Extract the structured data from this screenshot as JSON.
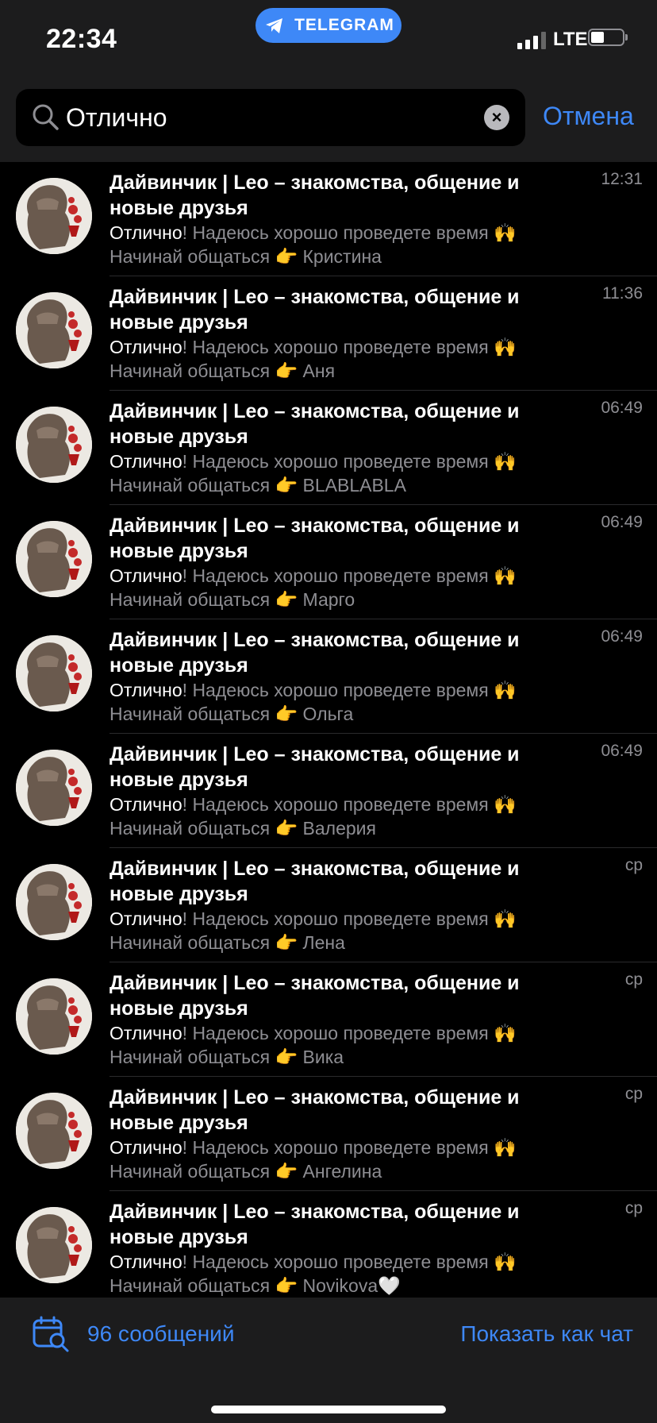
{
  "status_bar": {
    "time": "22:34",
    "app_pill": "TELEGRAM",
    "network": "LTE"
  },
  "search": {
    "query": "Отлично",
    "cancel_label": "Отмена"
  },
  "results": [
    {
      "title": "Дайвинчик | Leo – знакомства, общение и новые друзья",
      "time": "12:31",
      "highlight": "Отлично",
      "rest": "! Надеюсь хорошо проведете время 🙌",
      "line2": "Начинай общаться 👉 Кристина"
    },
    {
      "title": "Дайвинчик | Leo – знакомства, общение и новые друзья",
      "time": "11:36",
      "highlight": "Отлично",
      "rest": "! Надеюсь хорошо проведете время 🙌",
      "line2": "Начинай общаться 👉 Аня"
    },
    {
      "title": "Дайвинчик | Leo – знакомства, общение и новые друзья",
      "time": "06:49",
      "highlight": "Отлично",
      "rest": "! Надеюсь хорошо проведете время 🙌",
      "line2": "Начинай общаться 👉 BLABLABLA"
    },
    {
      "title": "Дайвинчик | Leo – знакомства, общение и новые друзья",
      "time": "06:49",
      "highlight": "Отлично",
      "rest": "! Надеюсь хорошо проведете время 🙌",
      "line2": "Начинай общаться 👉 Марго"
    },
    {
      "title": "Дайвинчик | Leo – знакомства, общение и новые друзья",
      "time": "06:49",
      "highlight": "Отлично",
      "rest": "! Надеюсь хорошо проведете время 🙌",
      "line2": "Начинай общаться 👉 Ольга"
    },
    {
      "title": "Дайвинчик | Leo – знакомства, общение и новые друзья",
      "time": "06:49",
      "highlight": "Отлично",
      "rest": "! Надеюсь хорошо проведете время 🙌",
      "line2": "Начинай общаться 👉 Валерия"
    },
    {
      "title": "Дайвинчик | Leo – знакомства, общение и новые друзья",
      "time": "ср",
      "highlight": "Отлично",
      "rest": "! Надеюсь хорошо проведете время 🙌",
      "line2": "Начинай общаться 👉 Лена"
    },
    {
      "title": "Дайвинчик | Leo – знакомства, общение и новые друзья",
      "time": "ср",
      "highlight": "Отлично",
      "rest": "! Надеюсь хорошо проведете время 🙌",
      "line2": "Начинай общаться 👉 Вика"
    },
    {
      "title": "Дайвинчик | Leo – знакомства, общение и новые друзья",
      "time": "ср",
      "highlight": "Отлично",
      "rest": "! Надеюсь хорошо проведете время 🙌",
      "line2": "Начинай общаться 👉 Ангелина"
    },
    {
      "title": "Дайвинчик | Leo – знакомства, общение и новые друзья",
      "time": "ср",
      "highlight": "Отлично",
      "rest": "! Надеюсь хорошо проведете время 🙌",
      "line2": "Начинай общаться 👉 Novikova🤍"
    }
  ],
  "bottom_bar": {
    "count_label": "96 сообщений",
    "show_as_chat_label": "Показать как чат"
  },
  "colors": {
    "accent": "#3e88f7",
    "background": "#000000",
    "bar": "#1c1c1d",
    "secondary_text": "#8e8e93"
  }
}
